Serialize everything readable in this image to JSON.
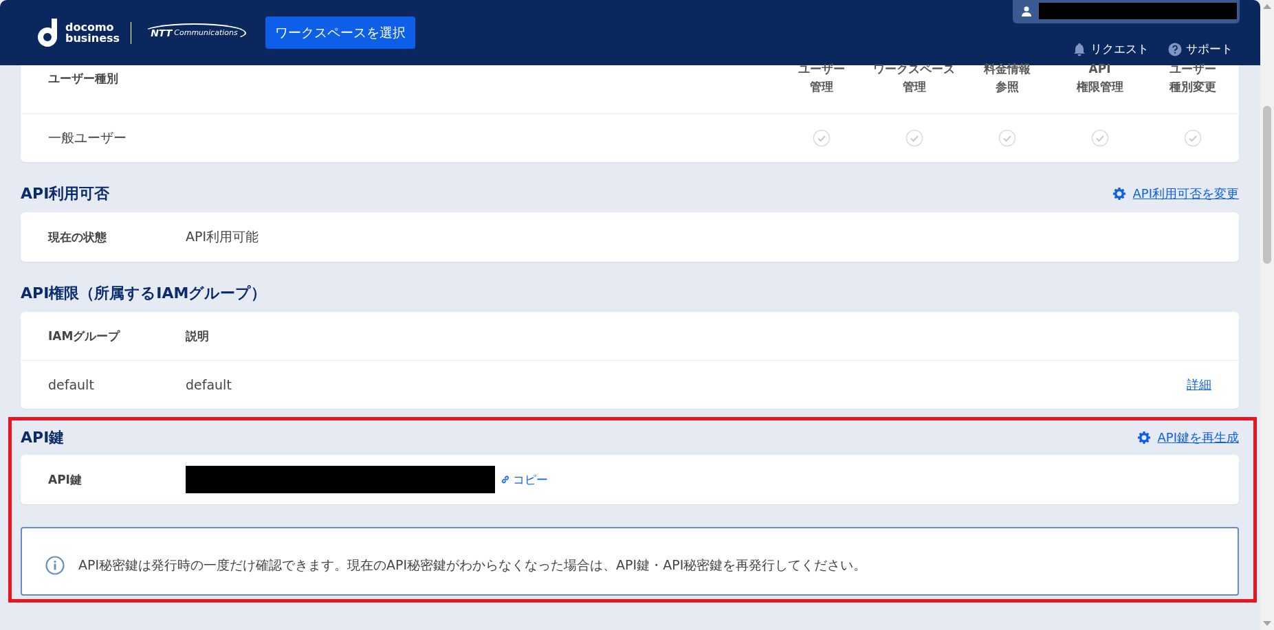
{
  "header": {
    "logo": {
      "line1": "docomo",
      "line2": "business",
      "partner_mark": "NTT",
      "partner_name": "Communications"
    },
    "workspace_button": "ワークスペースを選択",
    "nav": [
      {
        "kind": "bell",
        "label": "リクエスト"
      },
      {
        "kind": "help",
        "label": "サポート"
      }
    ]
  },
  "role_table": {
    "columns": [
      {
        "lines": [
          "ユーザー種別"
        ]
      },
      {
        "lines": [
          "ユーザー",
          "管理"
        ]
      },
      {
        "lines": [
          "ワークスペース",
          "管理"
        ]
      },
      {
        "lines": [
          "料金情報",
          "参照"
        ]
      },
      {
        "lines": [
          "API",
          "権限管理"
        ]
      },
      {
        "lines": [
          "ユーザー",
          "種別変更"
        ]
      }
    ],
    "rows": [
      {
        "role": "一般ユーザー",
        "permissions": [
          {
            "checked": false
          },
          {
            "checked": false
          },
          {
            "checked": false
          },
          {
            "checked": false
          },
          {
            "checked": false
          }
        ]
      }
    ]
  },
  "api_usage": {
    "title": "API利用可否",
    "action_link": "API利用可否を変更",
    "label": "現在の状態",
    "value": "API利用可能"
  },
  "api_permissions": {
    "title": "API権限（所属するIAMグループ）",
    "columns": [
      "IAMグループ",
      "説明"
    ],
    "rows": [
      {
        "group": "default",
        "description": "default",
        "link": "詳細"
      }
    ]
  },
  "api_key": {
    "highlighted": true,
    "title": "API鍵",
    "action_link": "API鍵を再生成",
    "label": "API鍵",
    "copy_link": "コピー",
    "notice": "API秘密鍵は発行時の一度だけ確認できます。現在のAPI秘密鍵がわからなくなった場合は、API鍵・API秘密鍵を再発行してください。"
  }
}
